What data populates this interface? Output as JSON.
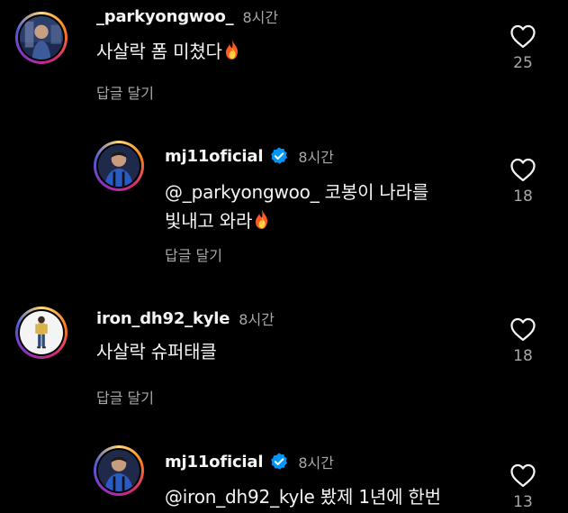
{
  "comments": [
    {
      "username": "_parkyongwoo_",
      "time": "8시간",
      "text": "사살락 폼 미쳤다",
      "emoji": "fire",
      "reply_label": "답글 달기",
      "likes": "25",
      "verified": false
    },
    {
      "username": "mj11oficial",
      "time": "8시간",
      "line1": "@_parkyongwoo_ 코봉이 나라를",
      "line2": "빛내고 와라",
      "emoji": "fire",
      "reply_label": "답글 달기",
      "likes": "18",
      "verified": true
    },
    {
      "username": "iron_dh92_kyle",
      "time": "8시간",
      "text": "사살락 슈퍼태클",
      "reply_label": "답글 달기",
      "likes": "18",
      "verified": false
    },
    {
      "username": "mj11oficial",
      "time": "8시간",
      "line1": "@iron_dh92_kyle 봤제 1년에 한번",
      "likes": "13",
      "verified": true
    }
  ],
  "colors": {
    "background": "#000000",
    "text": "#f5f5f5",
    "secondary": "#a8a8a8",
    "verified_blue": "#0095f6"
  },
  "icons": {
    "like": "heart-outline-icon",
    "verified": "verified-badge-icon",
    "emoji": "fire-emoji"
  }
}
